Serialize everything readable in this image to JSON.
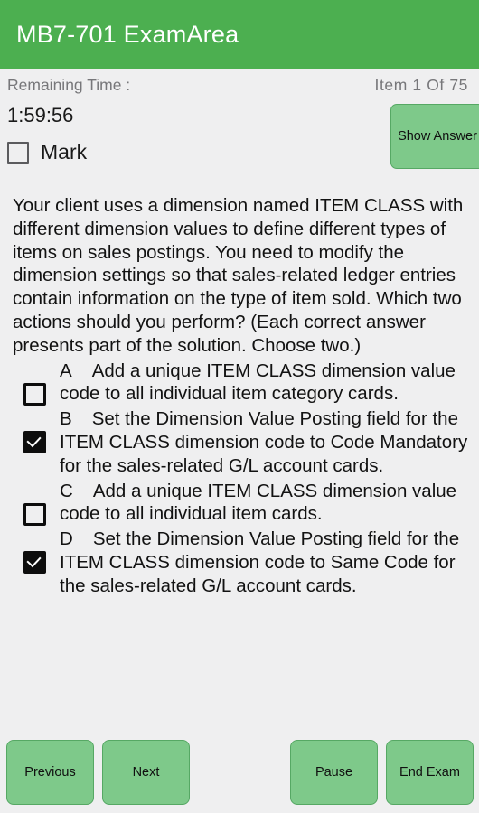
{
  "app": {
    "title": "MB7-701 ExamArea",
    "header_color": "#4CAF50",
    "background_color": "#efeff0",
    "button_color": "#7ec98a"
  },
  "status": {
    "remaining_time_label": "Remaining Time :",
    "item_counter": "Item  1  Of  75"
  },
  "timer": {
    "value": "1:59:56"
  },
  "mark": {
    "label": "Mark",
    "checked": false
  },
  "show_answer": {
    "label": "Show Answer"
  },
  "question": {
    "text": "Your client uses a dimension named ITEM CLASS with different dimension values to define different types of items on sales postings. You need to modify the dimension settings so that sales-related ledger entries contain information on the type of item sold. Which two actions should you perform? (Each correct answer presents part of the solution. Choose two.)"
  },
  "options": [
    {
      "letter": "A",
      "text": "Add a unique ITEM CLASS dimension value code to all individual item category cards.",
      "checked": false
    },
    {
      "letter": "B",
      "text": "Set the Dimension Value Posting field for the ITEM CLASS dimension code to Code Mandatory for the sales-related G/L account cards.",
      "checked": true
    },
    {
      "letter": "C",
      "text": "Add a unique ITEM CLASS dimension value code to all individual item cards.",
      "checked": false
    },
    {
      "letter": "D",
      "text": "Set the Dimension Value Posting field for the ITEM CLASS dimension code to Same Code for the sales-related G/L account cards.",
      "checked": true
    }
  ],
  "nav": {
    "previous_label": "Previous",
    "next_label": "Next",
    "pause_label": "Pause",
    "end_exam_label": "End Exam"
  }
}
